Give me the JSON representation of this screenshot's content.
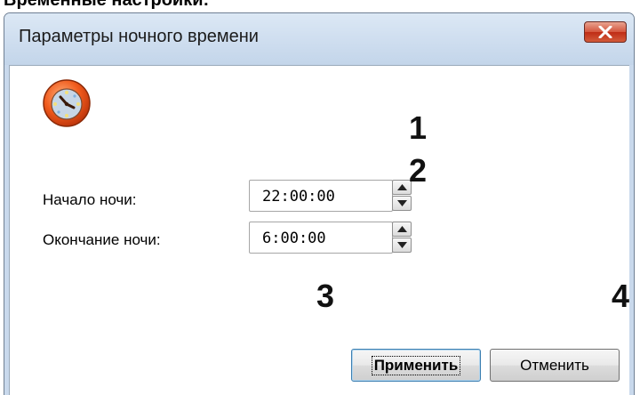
{
  "document": {
    "caption": "Временные настройки:"
  },
  "dialog": {
    "title": "Параметры ночного времени",
    "icon": "clock-icon",
    "fields": {
      "night_start": {
        "label": "Начало ночи:",
        "value": "22:00:00"
      },
      "night_end": {
        "label": "Окончание ночи:",
        "value": "6:00:00"
      }
    },
    "buttons": {
      "apply": "Применить",
      "cancel": "Отменить"
    }
  },
  "callouts": {
    "c1": "1",
    "c2": "2",
    "c3": "3",
    "c4": "4"
  },
  "colors": {
    "titlebar": "#c9d9ec",
    "close_button": "#c8381e",
    "apply_border": "#3c7fb1"
  }
}
